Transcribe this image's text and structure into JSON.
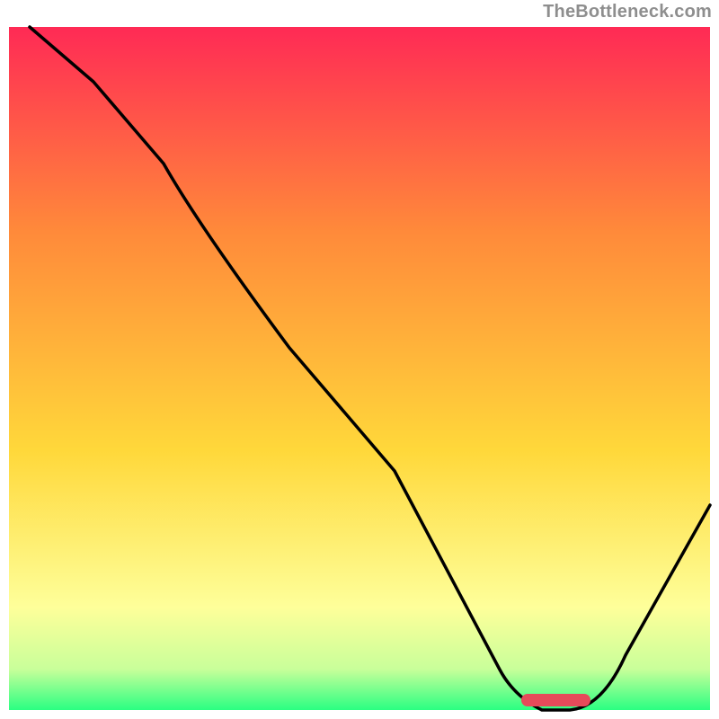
{
  "watermark": "TheBottleneck.com",
  "colors": {
    "gradient_top": "#ff2a55",
    "gradient_mid1": "#ff8a3a",
    "gradient_mid2": "#ffd83a",
    "gradient_pale": "#feff9a",
    "gradient_light_green": "#c9ff9a",
    "gradient_green": "#2aff82",
    "curve_stroke": "#000000",
    "pill_stroke": "#e64a5a",
    "pill_fill": "#e64a5a"
  },
  "chart_data": {
    "type": "line",
    "title": "",
    "xlabel": "",
    "ylabel": "",
    "xlim": [
      0,
      100
    ],
    "ylim": [
      0,
      100
    ],
    "grid": false,
    "series": [
      {
        "name": "bottleneck-curve",
        "x": [
          3,
          12,
          22,
          27,
          40,
          55,
          70,
          72,
          76,
          80,
          88,
          100
        ],
        "y": [
          100,
          92,
          80,
          71,
          53,
          35,
          6,
          2,
          0,
          0,
          8,
          30
        ]
      }
    ],
    "annotations": [
      {
        "name": "optimal-band-marker",
        "x_start": 74,
        "x_end": 82,
        "y": 1.5,
        "color": "#e64a5a"
      }
    ],
    "legend": null
  }
}
